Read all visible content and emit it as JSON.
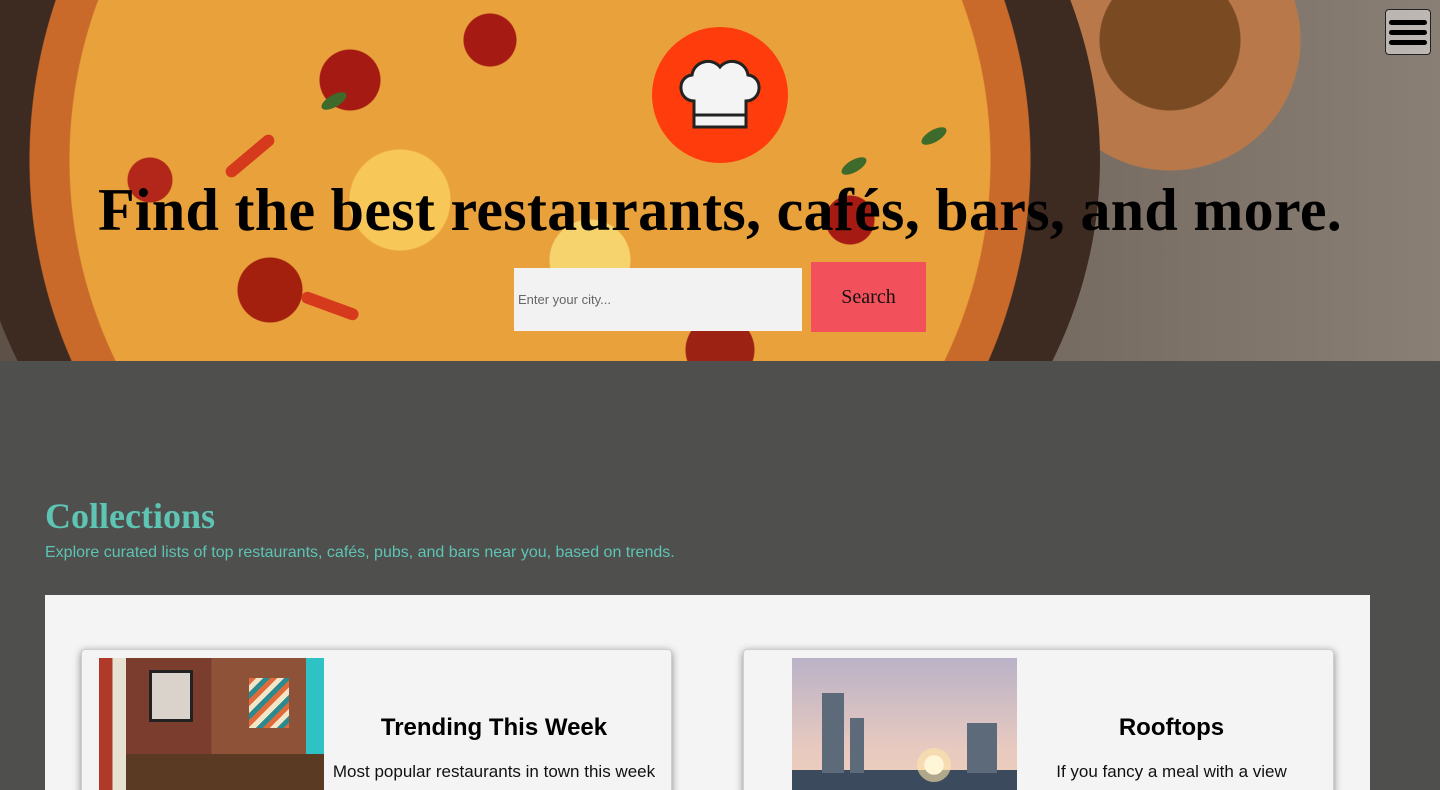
{
  "header": {
    "logo_icon": "chef-hat-icon",
    "menu_icon": "hamburger-menu-icon",
    "title": "Find the best restaurants, cafés, bars, and more.",
    "search": {
      "placeholder": "Enter your city...",
      "value": "",
      "button_label": "Search"
    }
  },
  "collections": {
    "title": "Collections",
    "subtitle": "Explore curated lists of top restaurants, cafés, pubs, and bars near you, based on trends.",
    "cards": [
      {
        "title": "Trending This Week",
        "description": "Most popular restaurants in town this week"
      },
      {
        "title": "Rooftops",
        "description": "If you fancy a meal with a view"
      }
    ]
  },
  "colors": {
    "accent": "#5ec4b4",
    "search_button": "#f2505b",
    "logo_bg": "#ff3d0c",
    "page_bg": "#4f4f4e"
  }
}
